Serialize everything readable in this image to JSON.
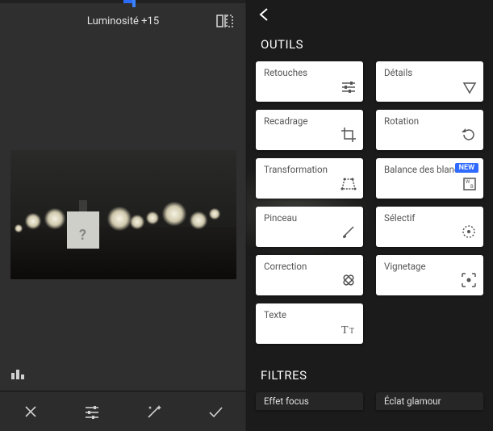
{
  "left": {
    "adjustment_label": "Luminosité +15"
  },
  "right": {
    "section_tools": "OUTILS",
    "section_filters": "FILTRES",
    "new_badge": "NEW",
    "tools": [
      {
        "label": "Retouches"
      },
      {
        "label": "Détails"
      },
      {
        "label": "Recadrage"
      },
      {
        "label": "Rotation"
      },
      {
        "label": "Transformation"
      },
      {
        "label": "Balance des blancs"
      },
      {
        "label": "Pinceau"
      },
      {
        "label": "Sélectif"
      },
      {
        "label": "Correction"
      },
      {
        "label": "Vignetage"
      },
      {
        "label": "Texte"
      }
    ],
    "filters": [
      {
        "label": "Effet focus"
      },
      {
        "label": "Éclat glamour"
      }
    ]
  }
}
